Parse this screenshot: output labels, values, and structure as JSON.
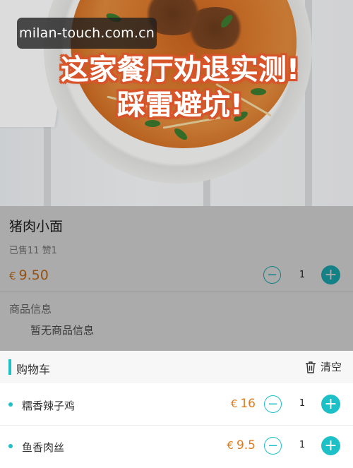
{
  "watermark": {
    "text": "milan-touch.com.cn"
  },
  "headline": {
    "line1": "这家餐厅劝退实测!",
    "line2": "踩雷避坑!"
  },
  "product": {
    "name": "猪肉小面",
    "stats": "已售11  赞1",
    "currency": "€",
    "price": "9.50",
    "quantity": "1",
    "info_title": "商品信息",
    "info_text": "暂无商品信息"
  },
  "cart": {
    "title": "购物车",
    "clear_label": "清空",
    "items": [
      {
        "name": "糯香辣子鸡",
        "currency": "€",
        "price": "16",
        "quantity": "1"
      },
      {
        "name": "鱼香肉丝",
        "currency": "€",
        "price": "9.5",
        "quantity": "1"
      }
    ]
  },
  "colors": {
    "accent": "#1ec0c8",
    "price": "#e07a18",
    "headline_outline": "#d8542a"
  },
  "icons": {
    "minus": "minus-circle-icon",
    "plus": "plus-circle-icon",
    "trash": "trash-icon"
  }
}
